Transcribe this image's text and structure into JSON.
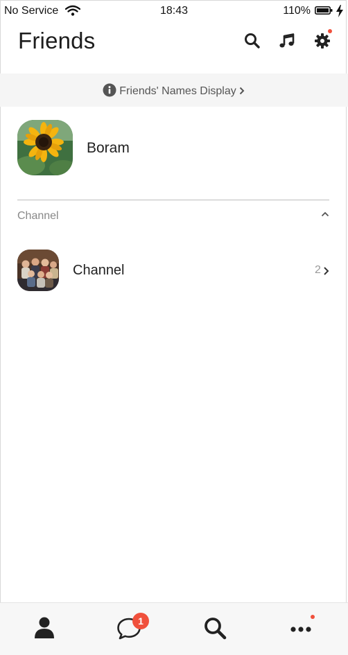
{
  "status_bar": {
    "carrier": "No Service",
    "time": "18:43",
    "battery_percent": "110%"
  },
  "header": {
    "title": "Friends",
    "icons": [
      "search-icon",
      "music-icon",
      "gear-icon"
    ],
    "settings_has_notification": true
  },
  "banner": {
    "label": "Friends' Names Display"
  },
  "profile": {
    "name": "Boram",
    "avatar": "sunflower-image"
  },
  "channel_section": {
    "label": "Channel",
    "expanded": true,
    "items": [
      {
        "name": "Channel",
        "count": "2",
        "avatar": "group-photo"
      }
    ]
  },
  "bottom_nav": {
    "items": [
      {
        "icon": "person-icon",
        "active": true
      },
      {
        "icon": "chat-icon",
        "badge": "1"
      },
      {
        "icon": "search-icon"
      },
      {
        "icon": "more-icon",
        "has_notification": true
      }
    ]
  },
  "colors": {
    "accent_red": "#f0503c",
    "banner_bg": "#f5f5f5",
    "nav_bg": "#f7f7f7",
    "icon_dark": "#222222"
  }
}
